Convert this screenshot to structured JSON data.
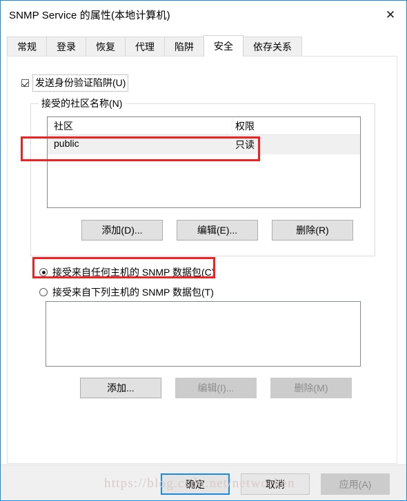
{
  "window": {
    "title": "SNMP Service 的属性(本地计算机)",
    "close_icon": "close-icon",
    "accent_color": "#1a8ae0"
  },
  "tabs": [
    {
      "label": "常规",
      "selected": false
    },
    {
      "label": "登录",
      "selected": false
    },
    {
      "label": "恢复",
      "selected": false
    },
    {
      "label": "代理",
      "selected": false
    },
    {
      "label": "陷阱",
      "selected": false
    },
    {
      "label": "安全",
      "selected": true
    },
    {
      "label": "依存关系",
      "selected": false
    }
  ],
  "security": {
    "send_auth_trap": {
      "label": "发送身份验证陷阱(U)",
      "accesskey": "U",
      "checked": true
    },
    "community_group": {
      "legend": "接受的社区名称(N)",
      "accesskey": "N",
      "columns": [
        "社区",
        "权限"
      ],
      "rows": [
        {
          "community": "public",
          "permission": "只读",
          "selected": true
        }
      ],
      "buttons": [
        {
          "label": "添加(D)...",
          "accesskey": "D",
          "enabled": true
        },
        {
          "label": "编辑(E)...",
          "accesskey": "E",
          "enabled": true
        },
        {
          "label": "删除(R)",
          "accesskey": "R",
          "enabled": true
        }
      ]
    },
    "accept_any_host": {
      "label": "接受来自任何主机的 SNMP 数据包(C)",
      "accesskey": "C",
      "selected": true
    },
    "accept_listed_hosts": {
      "label": "接受来自下列主机的 SNMP 数据包(T)",
      "accesskey": "T",
      "selected": false
    },
    "host_list": {
      "items": []
    },
    "host_buttons": [
      {
        "label": "添加...",
        "accesskey": "",
        "enabled": true
      },
      {
        "label": "编辑(I)...",
        "accesskey": "I",
        "enabled": false
      },
      {
        "label": "删除(M)",
        "accesskey": "M",
        "enabled": false
      }
    ]
  },
  "footer": {
    "ok": {
      "label": "确定",
      "default": true,
      "enabled": true
    },
    "cancel": {
      "label": "取消",
      "default": false,
      "enabled": true
    },
    "apply": {
      "label": "应用(A)",
      "accesskey": "A",
      "enabled": false
    }
  },
  "annotations": {
    "color": "#f22121",
    "boxes": [
      "community-row-public",
      "accept-any-host-radio"
    ]
  },
  "watermark": {
    "text": "https://blog.csdn.net/networken"
  }
}
